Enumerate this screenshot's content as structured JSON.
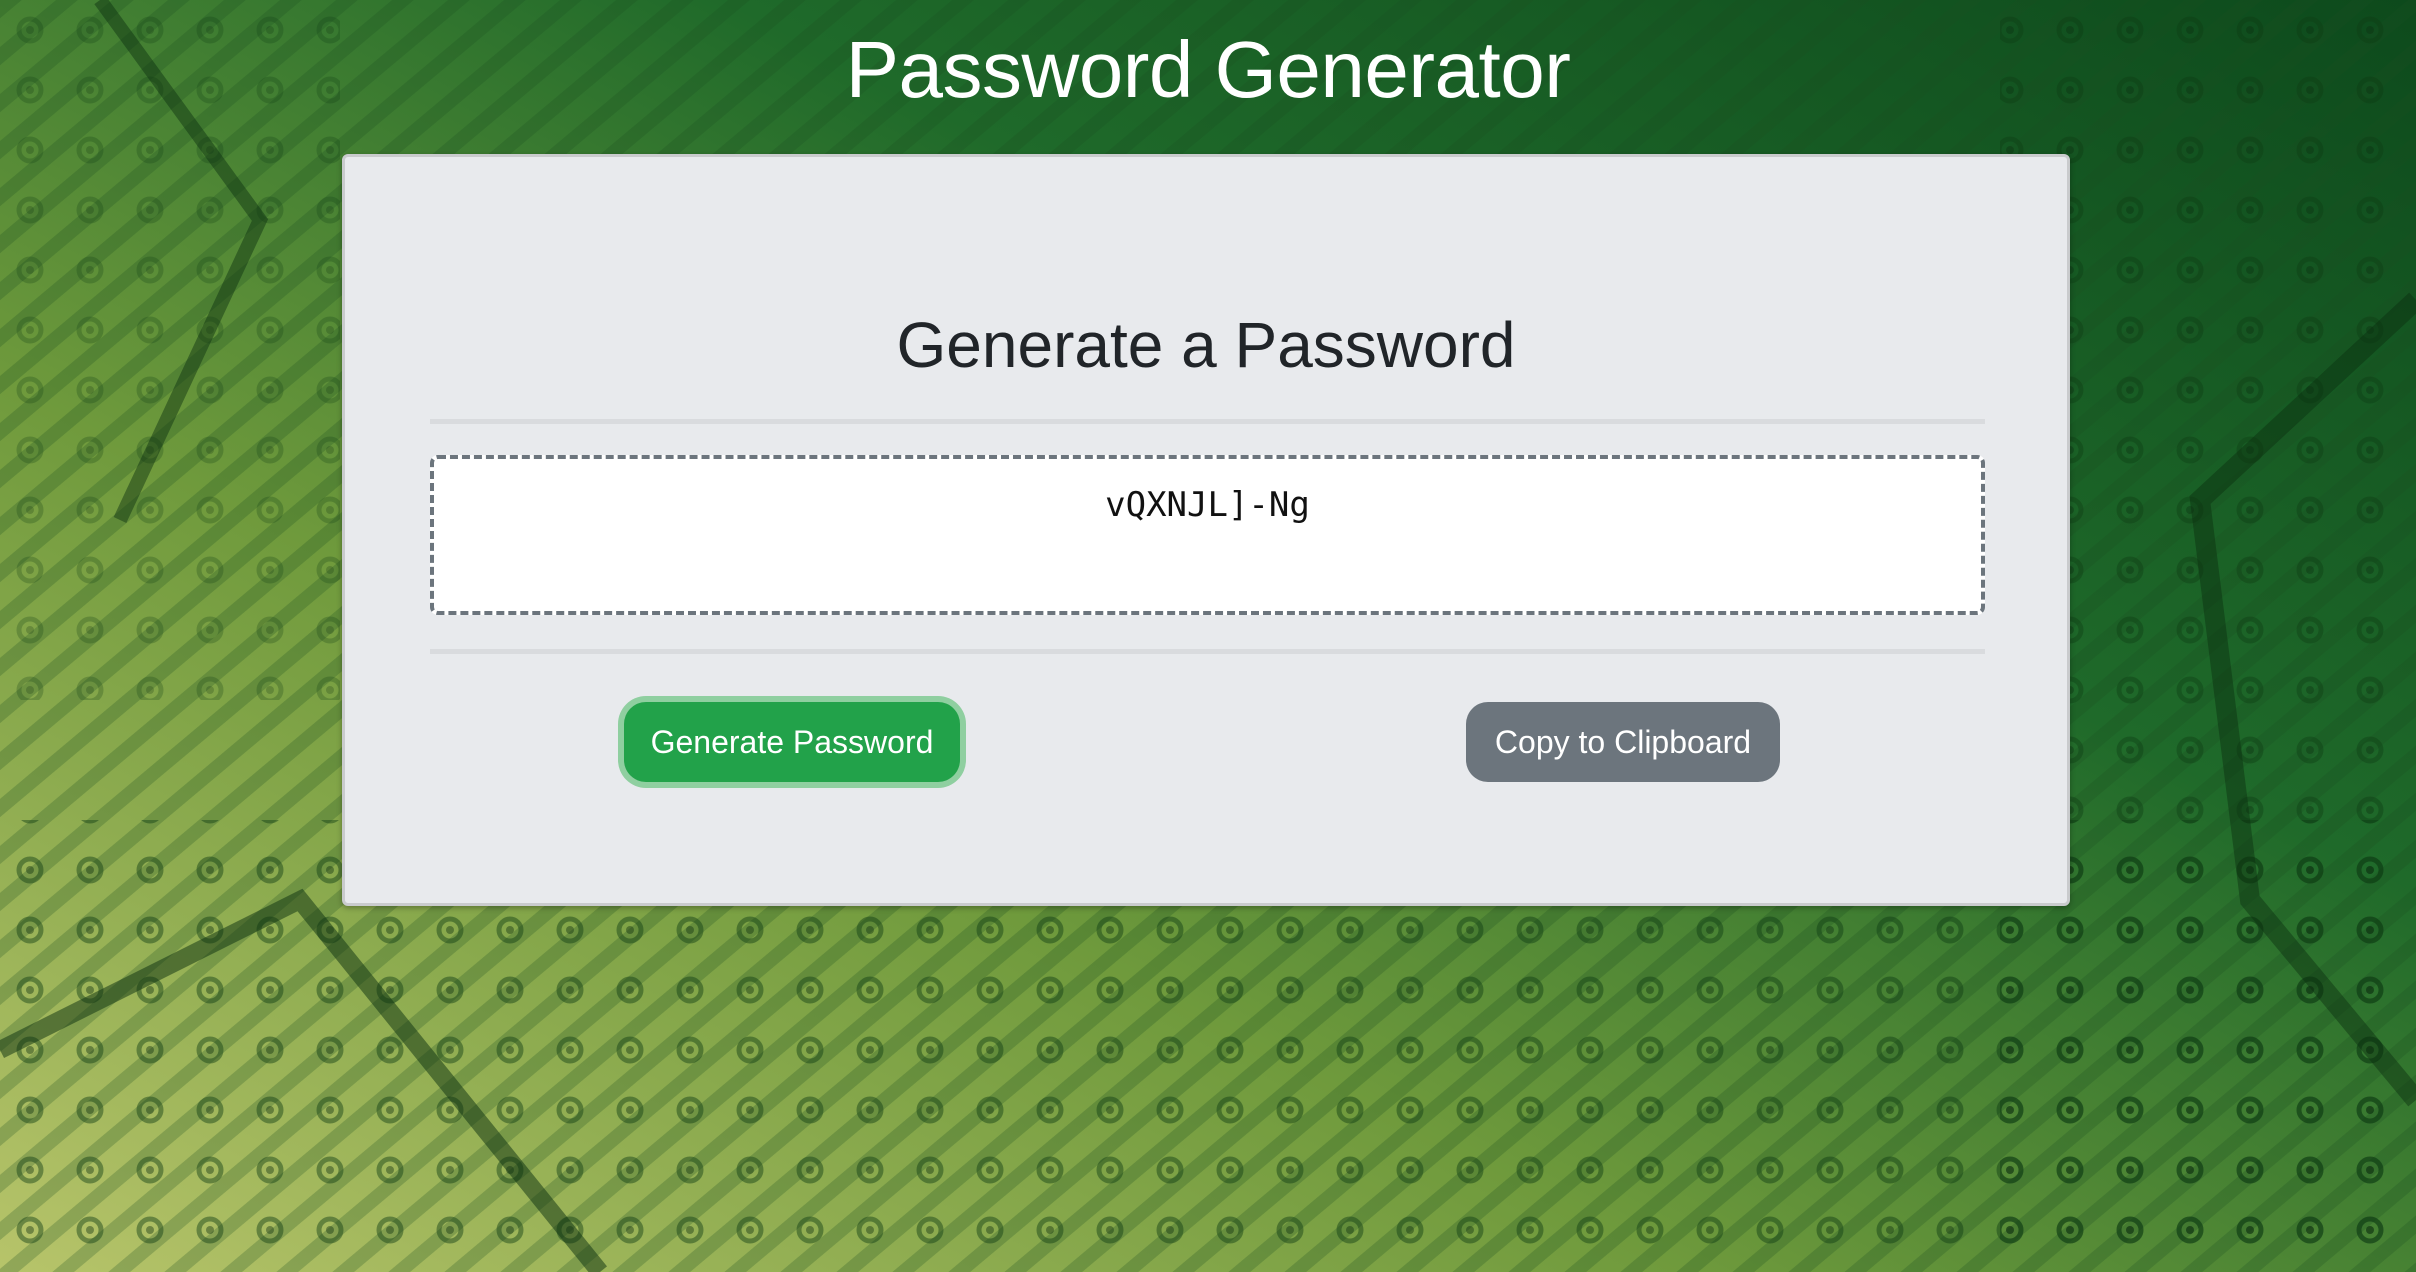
{
  "page": {
    "title": "Password Generator"
  },
  "card": {
    "heading": "Generate a Password",
    "password_value": "vQXNJL]-Ng",
    "generate_label": "Generate Password",
    "copy_label": "Copy to Clipboard"
  },
  "colors": {
    "generate_button": "#22a24a",
    "copy_button": "#6c757d",
    "card_background": "#e8eaed",
    "background_theme": "green circuit board"
  }
}
